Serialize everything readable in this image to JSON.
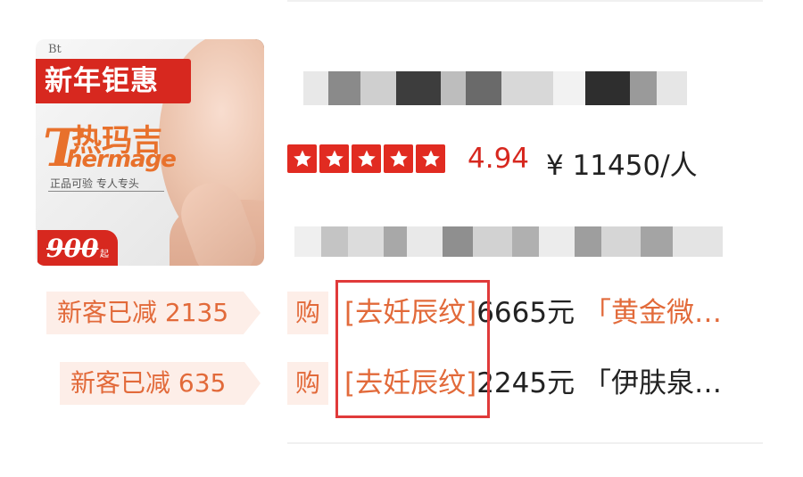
{
  "listing": {
    "thumbnail": {
      "promo_badge": "新年钜惠",
      "brand_cn": "热玛吉",
      "brand_en": "hermage",
      "brand_en_initial": "T",
      "subtitle": "正品可验  专人专头",
      "price_badge": "900",
      "price_badge_unit": "起",
      "corner_mark": "Bt"
    },
    "rating": {
      "stars": 5,
      "score": "4.94",
      "star_color": "#e12b21"
    },
    "price": "¥ 11450/人",
    "coupons": [
      {
        "new_customer_label": "新客已减 2135",
        "buy_label": "购",
        "tag": "[去妊辰纹]",
        "price": "6665元",
        "item_name": "「黄金微…",
        "item_name_color": "#e26a3a"
      },
      {
        "new_customer_label": "新客已减 635",
        "buy_label": "购",
        "tag": "[去妊辰纹]",
        "price": "2245元",
        "item_name": "「伊肤泉…",
        "item_name_color": "#222222"
      }
    ],
    "accent_color": "#d7281f",
    "highlight_color": "#e03a3a"
  }
}
